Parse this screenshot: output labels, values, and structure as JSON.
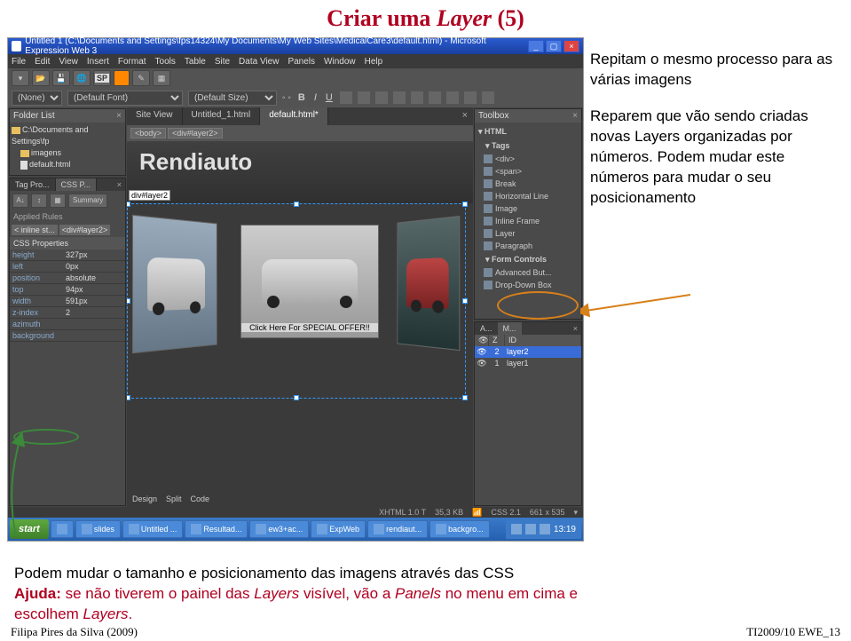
{
  "slide": {
    "title_pre": "Criar uma ",
    "title_em": "Layer",
    "title_post": " (5)"
  },
  "titlebar": {
    "text": "Untitled 1 (C:\\Documents and Settings\\fps14324\\My Documents\\My Web Sites\\MedicalCare3\\default.html) - Microsoft Expression Web 3"
  },
  "menus": [
    "File",
    "Edit",
    "View",
    "Insert",
    "Format",
    "Tools",
    "Table",
    "Site",
    "Data View",
    "Panels",
    "Window",
    "Help"
  ],
  "toolbar2": {
    "para": "(None)",
    "font": "(Default Font)",
    "size": "(Default Size)"
  },
  "folder": {
    "title": "Folder List",
    "root": "C:\\Documents and Settings\\fp",
    "items": [
      "imagens",
      "default.html"
    ]
  },
  "tagcss": {
    "tab1": "Tag Pro...",
    "tab2": "CSS P...",
    "summary": "Summary",
    "applied": "Applied Rules",
    "rule1": "< inline st...",
    "rule2": "<div#layer2>",
    "props_title": "CSS Properties",
    "props": [
      {
        "p": "height",
        "v": "327px"
      },
      {
        "p": "left",
        "v": "0px"
      },
      {
        "p": "position",
        "v": "absolute"
      },
      {
        "p": "top",
        "v": "94px"
      },
      {
        "p": "width",
        "v": "591px"
      },
      {
        "p": "z-index",
        "v": "2"
      },
      {
        "p": "azimuth",
        "v": ""
      },
      {
        "p": "background",
        "v": ""
      }
    ]
  },
  "doctabs": {
    "t1": "Site View",
    "t2": "Untitled_1.html",
    "t3": "default.html*"
  },
  "breadcrumb": {
    "b1": "<body>",
    "b2": "<div#layer2>"
  },
  "canvas": {
    "logo": "Rendiauto",
    "layerlabel": "div#layer2",
    "offer": "Click Here For SPECIAL OFFER!!"
  },
  "designtabs": [
    "Design",
    "Split",
    "Code"
  ],
  "toolbox": {
    "title": "Toolbox",
    "sect1": "HTML",
    "sect2": "Tags",
    "items": [
      "<div>",
      "<span>",
      "Break",
      "Horizontal Line",
      "Image",
      "Inline Frame",
      "Layer",
      "Paragraph"
    ],
    "sect3": "Form Controls",
    "items2": [
      "Advanced But...",
      "Drop-Down Box"
    ]
  },
  "layerpanel": {
    "tab1": "A...",
    "tab2": "M...",
    "hdr_eye": "👁",
    "hdr_z": "Z",
    "hdr_id": "ID",
    "rows": [
      {
        "z": "2",
        "id": "layer2",
        "sel": true
      },
      {
        "z": "1",
        "id": "layer1",
        "sel": false
      }
    ]
  },
  "status": {
    "left": "",
    "xhtml": "XHTML 1.0 T",
    "size": "35,3 KB",
    "css": "CSS 2.1",
    "dim": "661 x 535"
  },
  "taskbar": {
    "start": "start",
    "tasks": [
      "slides",
      "Untitled ...",
      "Resultad...",
      "ew3+ac...",
      "ExpWeb",
      "rendiaut...",
      "backgro..."
    ],
    "time": "13:19"
  },
  "annotations": {
    "p1": "Repitam o mesmo processo para as várias imagens",
    "p2": "Reparem que vão sendo criadas novas Layers organizadas por números. Podem mudar este números para mudar o seu posicionamento"
  },
  "bottom": {
    "line1": "Podem mudar o tamanho e posicionamento das imagens através das  CSS",
    "help_label": "Ajuda:",
    "help_rest_1": " se não tiverem o painel das ",
    "help_em1": "Layers",
    "help_rest_2": " visível, vão a ",
    "help_em2": "Panels",
    "help_rest_3": " no menu em cima e escolhem ",
    "help_em3": "Layers",
    "help_rest_4": "."
  },
  "footer": {
    "left": "Filipa Pires da Silva (2009)",
    "right": "TI2009/10 EWE_13"
  }
}
